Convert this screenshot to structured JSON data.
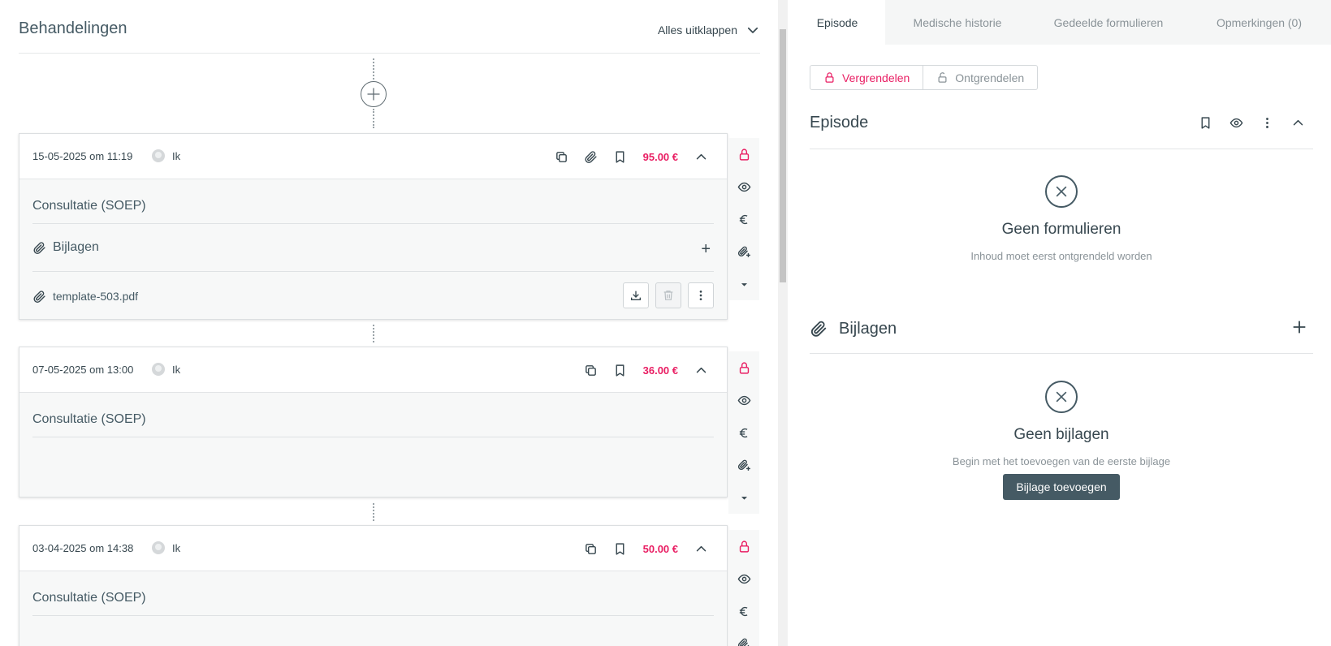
{
  "left": {
    "title": "Behandelingen",
    "expand_all": "Alles uitklappen"
  },
  "treatments": [
    {
      "date": "15-05-2025 om 11:19",
      "user": "Ik",
      "price": "95.00 €",
      "form_title": "Consultatie (SOEP)",
      "attachments_label": "Bijlagen",
      "attachment_add": "+",
      "file_name": "template-503.pdf"
    },
    {
      "date": "07-05-2025 om 13:00",
      "user": "Ik",
      "price": "36.00 €",
      "form_title": "Consultatie (SOEP)"
    },
    {
      "date": "03-04-2025 om 14:38",
      "user": "Ik",
      "price": "50.00 €",
      "form_title": "Consultatie (SOEP)"
    }
  ],
  "right": {
    "tabs": [
      "Episode",
      "Medische historie",
      "Gedeelde formulieren",
      "Opmerkingen (0)"
    ],
    "lock_label": "Vergrendelen",
    "unlock_label": "Ontgrendelen",
    "episode_title": "Episode",
    "no_forms_title": "Geen formulieren",
    "no_forms_sub": "Inhoud moet eerst ontgrendeld worden",
    "attachments_title": "Bijlagen",
    "no_attachments_title": "Geen bijlagen",
    "no_attachments_sub": "Begin met het toevoegen van de eerste bijlage",
    "add_attachment_btn": "Bijlage toevoegen"
  },
  "colors": {
    "accent_pink": "#e91e63",
    "slate": "#455a64",
    "muted": "#8a9398"
  }
}
